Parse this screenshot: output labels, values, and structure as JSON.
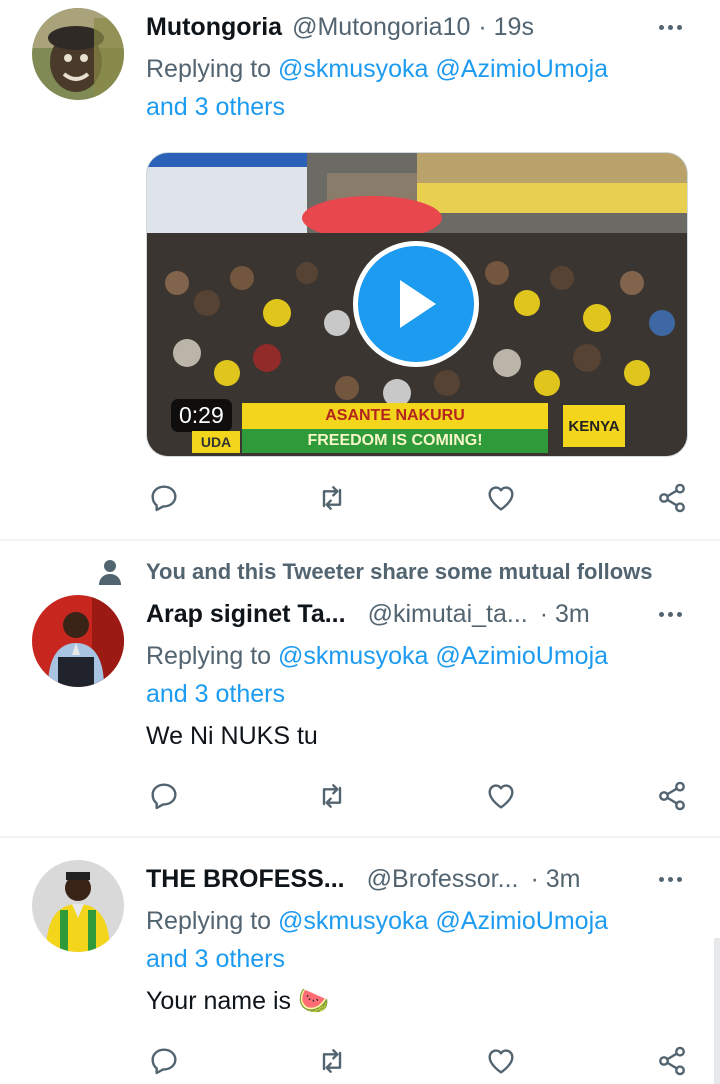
{
  "tweets": [
    {
      "name": "Mutongoria",
      "handle": "@Mutongoria10",
      "time": "· 19s",
      "replying_prefix": "Replying to ",
      "mentions": "@skmusyoka @AzimioUmoja",
      "others": "and 3 others",
      "media": {
        "duration": "0:29",
        "banner_line1": "ASANTE NAKURU",
        "banner_line2": "FREEDOM IS COMING!",
        "left_badge": "UDA",
        "right_badge": "KENYA"
      }
    },
    {
      "social_context": "You and this Tweeter share some mutual follows",
      "name": "Arap siginet Ta...",
      "handle": "@kimutai_ta...",
      "time": "· 3m",
      "replying_prefix": "Replying to ",
      "mentions": "@skmusyoka @AzimioUmoja",
      "others": "and 3 others",
      "text": "We Ni NUKS tu"
    },
    {
      "name": "THE BROFESS...",
      "handle": "@Brofessor...",
      "time": "· 3m",
      "replying_prefix": "Replying to ",
      "mentions": "@skmusyoka @AzimioUmoja",
      "others": "and 3 others",
      "text": "Your name is 🍉"
    }
  ],
  "icons": [
    "reply-icon",
    "retweet-icon",
    "like-icon",
    "share-icon",
    "more-icon",
    "person-icon",
    "play-icon"
  ],
  "colors": {
    "link": "#1d9bf0",
    "secondary": "#536471",
    "primary": "#0f1419",
    "divider": "#eff3f4"
  }
}
